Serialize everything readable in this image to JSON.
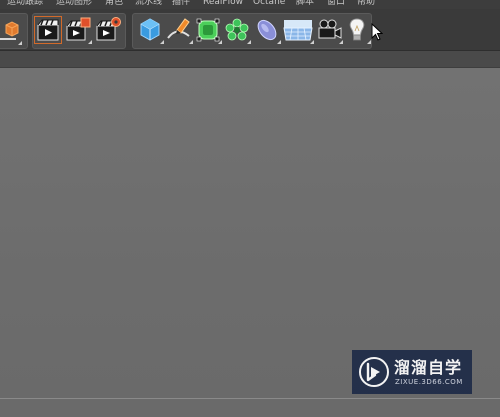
{
  "menubar": {
    "items": [
      "运动跟踪",
      "运动图形",
      "角色",
      "流水线",
      "插件",
      "RealFlow",
      "Octane",
      "脚本",
      "窗口",
      "帮助"
    ]
  },
  "toolbar": {
    "groups": [
      {
        "buttons": [
          "cube-axis-icon"
        ]
      },
      {
        "buttons": [
          "render-view-icon",
          "render-picture-viewer-icon",
          "render-settings-icon"
        ]
      },
      {
        "buttons": [
          "cube-primitive-icon",
          "spline-pen-icon",
          "subdivision-surface-icon",
          "cloner-icon",
          "deformer-icon",
          "floor-environment-icon",
          "camera-icon",
          "light-icon"
        ]
      }
    ],
    "active_button": "render-view-icon"
  },
  "colors": {
    "menubar_bg": "#3d3d3d",
    "toolbar_bg": "#3a3a3a",
    "viewport_bg": "#6c6c6c",
    "accent_orange": "#d26a2a",
    "watermark_bg": "#1e2b48"
  },
  "watermark": {
    "title": "溜溜自学",
    "url": "ZIXUE.3D66.COM"
  }
}
